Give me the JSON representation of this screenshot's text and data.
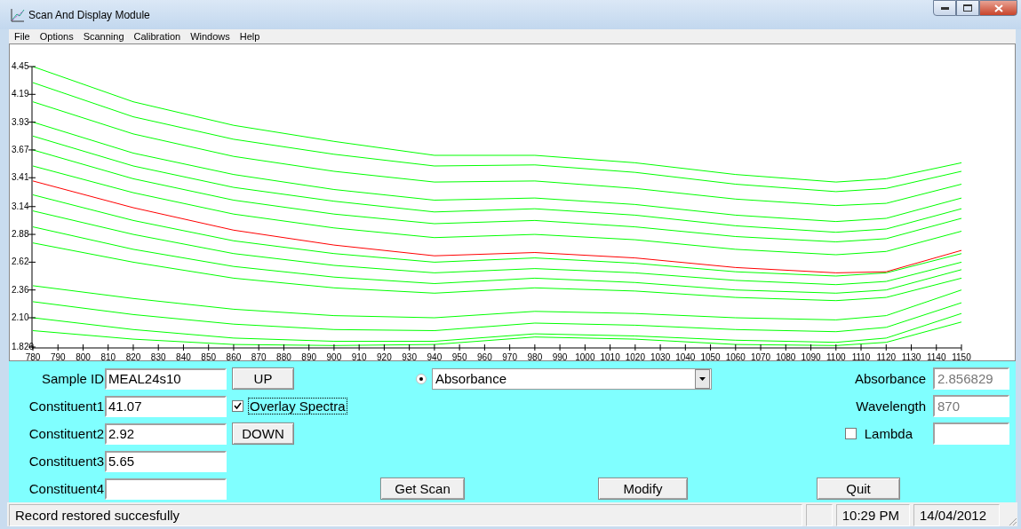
{
  "window": {
    "title": "Scan And Display Module"
  },
  "menu": [
    "File",
    "Options",
    "Scanning",
    "Calibration",
    "Windows",
    "Help"
  ],
  "spectra": {
    "chart_data": {
      "type": "line",
      "x": [
        780,
        820,
        860,
        900,
        940,
        980,
        1020,
        1060,
        1100,
        1120,
        1150
      ],
      "xlim": [
        780,
        1150
      ],
      "ylim": [
        1.826,
        4.45
      ],
      "xticks": [
        780,
        790,
        800,
        810,
        820,
        830,
        840,
        850,
        860,
        870,
        880,
        890,
        900,
        910,
        920,
        930,
        940,
        950,
        960,
        970,
        980,
        990,
        1000,
        1010,
        1020,
        1030,
        1040,
        1050,
        1060,
        1070,
        1080,
        1090,
        1100,
        1110,
        1120,
        1130,
        1140,
        1150
      ],
      "yticks": [
        {
          "value": 1.826,
          "label": "1.826"
        },
        {
          "value": 2.1,
          "label": "2.10"
        },
        2.36,
        2.62,
        2.88,
        3.14,
        3.41,
        3.67,
        3.93,
        4.19,
        4.45
      ],
      "series": [
        {
          "color": "#00ff00",
          "values": [
            4.45,
            4.12,
            3.9,
            3.75,
            3.62,
            3.62,
            3.55,
            3.44,
            3.37,
            3.4,
            3.55
          ]
        },
        {
          "color": "#00ff00",
          "values": [
            4.3,
            3.98,
            3.77,
            3.63,
            3.52,
            3.53,
            3.46,
            3.35,
            3.28,
            3.31,
            3.47
          ]
        },
        {
          "color": "#00ff00",
          "values": [
            4.12,
            3.82,
            3.61,
            3.47,
            3.37,
            3.38,
            3.31,
            3.21,
            3.15,
            3.17,
            3.35
          ]
        },
        {
          "color": "#00ff00",
          "values": [
            3.93,
            3.64,
            3.44,
            3.3,
            3.2,
            3.22,
            3.16,
            3.06,
            3.0,
            3.03,
            3.22
          ]
        },
        {
          "color": "#00ff00",
          "values": [
            3.8,
            3.52,
            3.32,
            3.19,
            3.09,
            3.12,
            3.06,
            2.96,
            2.9,
            2.93,
            3.12
          ]
        },
        {
          "color": "#00ff00",
          "values": [
            3.67,
            3.4,
            3.2,
            3.07,
            2.98,
            3.01,
            2.95,
            2.86,
            2.81,
            2.84,
            3.03
          ]
        },
        {
          "color": "#00ff00",
          "values": [
            3.52,
            3.27,
            3.07,
            2.94,
            2.85,
            2.88,
            2.83,
            2.74,
            2.69,
            2.72,
            2.91
          ]
        },
        {
          "color": "#00ff00",
          "values": [
            3.25,
            3.01,
            2.82,
            2.7,
            2.62,
            2.66,
            2.61,
            2.53,
            2.49,
            2.52,
            2.7
          ]
        },
        {
          "color": "#00ff00",
          "values": [
            3.1,
            2.88,
            2.7,
            2.59,
            2.52,
            2.56,
            2.52,
            2.45,
            2.41,
            2.44,
            2.62
          ]
        },
        {
          "color": "#00ff00",
          "values": [
            2.95,
            2.74,
            2.58,
            2.48,
            2.42,
            2.47,
            2.43,
            2.36,
            2.33,
            2.36,
            2.55
          ]
        },
        {
          "color": "#00ff00",
          "values": [
            2.8,
            2.62,
            2.47,
            2.38,
            2.33,
            2.38,
            2.35,
            2.29,
            2.26,
            2.29,
            2.47
          ]
        },
        {
          "color": "#00ff00",
          "values": [
            2.4,
            2.28,
            2.18,
            2.12,
            2.1,
            2.16,
            2.14,
            2.1,
            2.08,
            2.12,
            2.36
          ]
        },
        {
          "color": "#00ff00",
          "values": [
            2.25,
            2.13,
            2.04,
            1.99,
            1.98,
            2.05,
            2.03,
            1.99,
            1.97,
            2.01,
            2.24
          ]
        },
        {
          "color": "#00ff00",
          "values": [
            2.1,
            1.99,
            1.91,
            1.88,
            1.88,
            1.95,
            1.93,
            1.89,
            1.87,
            1.91,
            2.14
          ]
        },
        {
          "color": "#00ff00",
          "values": [
            1.98,
            1.9,
            1.85,
            1.84,
            1.85,
            1.92,
            1.9,
            1.85,
            1.84,
            1.87,
            2.06
          ]
        },
        {
          "color": "#ff0000",
          "values": [
            3.38,
            3.13,
            2.92,
            2.78,
            2.68,
            2.71,
            2.66,
            2.57,
            2.52,
            2.53,
            2.73
          ]
        }
      ]
    }
  },
  "sample_id": {
    "label": "Sample ID",
    "value": "MEAL24s10"
  },
  "constituents": [
    {
      "label": "Constituent1",
      "value": "41.07"
    },
    {
      "label": "Constituent2",
      "value": "2.92"
    },
    {
      "label": "Constituent3",
      "value": "5.65"
    },
    {
      "label": "Constituent4"
    }
  ],
  "up_button": "UP",
  "down_button": "DOWN",
  "overlay_spectra": {
    "label": "Overlay Spectra",
    "checked": true
  },
  "mode": {
    "selected": true,
    "value": "Absorbance"
  },
  "readouts": [
    {
      "label": "Absorbance",
      "value": "2.856829",
      "disabled": true
    },
    {
      "label": "Wavelength",
      "value": "870",
      "disabled": true
    }
  ],
  "lambda": {
    "label": "Lambda",
    "checked": false
  },
  "buttons": [
    "Get Scan",
    "Modify",
    "Quit"
  ],
  "status_bar": {
    "message": "Record restored succesfully",
    "time": "10:29 PM",
    "date": "14/04/2012"
  }
}
